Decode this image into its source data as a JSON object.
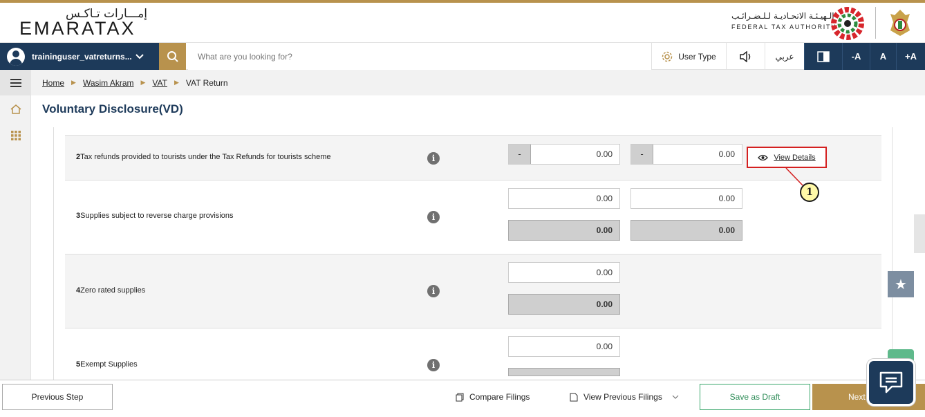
{
  "header": {
    "logo_arabic": "إمـــارات تـاكـس",
    "logo_english": "EMARATAX",
    "authority_arabic": "الـهيـئـة الاتحـاديـة لـلـضـرائـب",
    "authority_english": "FEDERAL TAX AUTHORITY",
    "fta_logo_icon": "fta-logo-icon",
    "emblem_icon": "uae-emblem-icon"
  },
  "navbar": {
    "username": "traininguser_vatreturns...",
    "search_placeholder": "What are you looking for?",
    "user_type_label": "User Type",
    "language_label": "عربي",
    "font_decrease": "-A",
    "font_normal": "A",
    "font_increase": "+A"
  },
  "breadcrumb": {
    "items": [
      "Home",
      "Wasim Akram",
      "VAT",
      "VAT Return"
    ]
  },
  "page": {
    "title": "Voluntary Disclosure(VD)"
  },
  "rows": [
    {
      "number": "2",
      "label": "Tax refunds provided to tourists under the Tax Refunds for tourists scheme",
      "amount": "0.00",
      "vat": "0.00",
      "minus": "-",
      "view_details": "View Details"
    },
    {
      "number": "3",
      "label": "Supplies subject to reverse charge provisions",
      "amount": "0.00",
      "vat": "0.00",
      "amount_calc": "0.00",
      "vat_calc": "0.00"
    },
    {
      "number": "4",
      "label": "Zero rated supplies",
      "amount": "0.00",
      "amount_calc": "0.00"
    },
    {
      "number": "5",
      "label": "Exempt Supplies",
      "amount": "0.00"
    }
  ],
  "annotation": {
    "callout_number": "1"
  },
  "footer": {
    "previous_step": "Previous Step",
    "compare_filings": "Compare Filings",
    "view_previous_filings": "View Previous Filings",
    "save_as_draft": "Save as Draft",
    "next": "Next"
  },
  "colors": {
    "navy": "#1d3a5a",
    "gold": "#b8924d",
    "green": "#3aa66b",
    "callout_red": "#d42020"
  }
}
